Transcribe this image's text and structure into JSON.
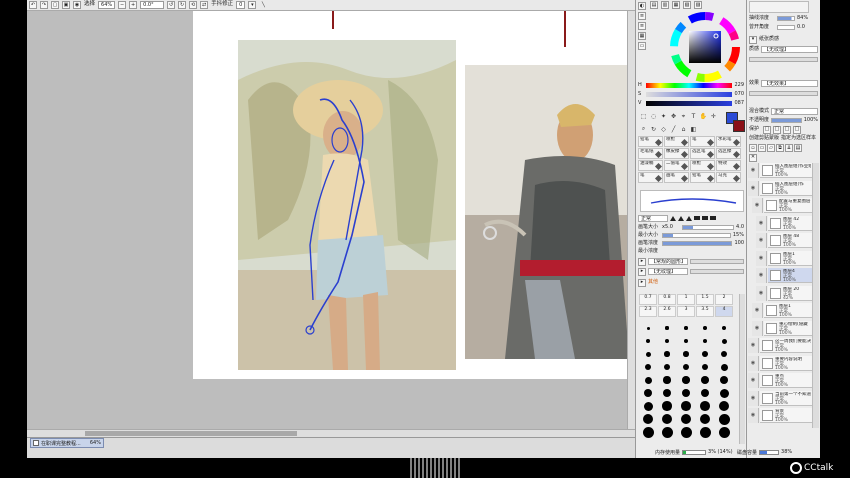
{
  "toolbar": {
    "zoom_mode": "选择",
    "zoom": "64%",
    "angle": "0.0°",
    "stabilizer_label": "手抖修正",
    "stabilizer_value": "0"
  },
  "doc_tab": {
    "name": "在职课完整教程...",
    "zoom": "64%"
  },
  "status": {
    "memory_label": "内存使用量",
    "memory_value": "3% (14%)",
    "disk_label": "磁盘容量",
    "disk_value": "38%"
  },
  "color": {
    "current": "#2b4bd6",
    "secondary": "#8a0f16",
    "h_label": "H",
    "h": "229",
    "s_label": "S",
    "s": "070",
    "v_label": "V",
    "v": "087"
  },
  "brush_tabs": [
    {
      "row": [
        "铅笔",
        "喷枪",
        "笔",
        "水彩笔"
      ]
    },
    {
      "row": [
        "毛笔纸",
        "橡皮擦",
        "选区笔",
        "选区擦"
      ]
    },
    {
      "row": [
        "油漆桶",
        "二值笔",
        "喷枪",
        "特效"
      ]
    },
    {
      "row": [
        "笔",
        "画笔",
        "铅笔",
        "马克"
      ]
    }
  ],
  "brush": {
    "blend": "正常",
    "size_label": "画笔大小",
    "size_mult": "x5.0",
    "size": "4.0",
    "min_size_label": "最小大小",
    "min_size": "15%",
    "density_label": "画笔浓度",
    "density": "100",
    "min_density_label": "最小浓度",
    "tex1": "【常规的圆形】",
    "tex2": "【无纹理】",
    "adv_label": "其他"
  },
  "size_presets": [
    "0.7",
    "0.8",
    "1",
    "1.5",
    "2",
    "2.3",
    "2.6",
    "3",
    "3.5",
    "4"
  ],
  "right": {
    "opacity_label": "抽线浓度",
    "opacity": "84%",
    "angle_label": "曾开角度",
    "angle": "0.0",
    "section1": "纸张质感",
    "texture_label": "质感",
    "texture": "【无纹理】",
    "effect_label": "效果",
    "effect": "【无效果】",
    "blend_label": "混合模式",
    "blend": "正常",
    "layer_opacity_label": "不透明度",
    "layer_opacity": "100%",
    "protect_label": "保护",
    "clip_label": "创建剪贴蒙版",
    "select_label": "指定为选区样本"
  },
  "layers": [
    {
      "name": "插入图层组(作业组",
      "sub1": "正常",
      "sub2": "100%",
      "sel": false,
      "indent": 0
    },
    {
      "name": "插入图层组(作",
      "sub1": "正常",
      "sub2": "100%",
      "sel": false,
      "indent": 0
    },
    {
      "name": "配置与重复图层",
      "sub1": "正常",
      "sub2": "100%",
      "sel": false,
      "indent": 1
    },
    {
      "name": "图层 42",
      "sub1": "正常",
      "sub2": "100%",
      "sel": false,
      "indent": 2
    },
    {
      "name": "图层 48",
      "sub1": "正常",
      "sub2": "100%",
      "sel": false,
      "indent": 2
    },
    {
      "name": "图层1",
      "sub1": "正常",
      "sub2": "100%",
      "sel": false,
      "indent": 2
    },
    {
      "name": "图层4",
      "sub1": "正常",
      "sub2": "100%",
      "sel": true,
      "indent": 2
    },
    {
      "name": "图层 20",
      "sub1": "正常",
      "sub2": "42%",
      "sel": false,
      "indent": 2
    },
    {
      "name": "图层1",
      "sub1": "正常",
      "sub2": "100%",
      "sel": false,
      "indent": 1
    },
    {
      "name": "重心绘制(隐藏",
      "sub1": "正常",
      "sub2": "100%",
      "sel": false,
      "indent": 1
    },
    {
      "name": "这一周我们要能决之",
      "sub1": "正常",
      "sub2": "100%",
      "sel": false,
      "indent": 0
    },
    {
      "name": "重要内容说明",
      "sub1": "正常",
      "sub2": "100%",
      "sel": false,
      "indent": 0
    },
    {
      "name": "重点",
      "sub1": "正常",
      "sub2": "100%",
      "sel": false,
      "indent": 0
    },
    {
      "name": "当前第一个不知道",
      "sub1": "正常",
      "sub2": "100%",
      "sel": false,
      "indent": 0
    },
    {
      "name": "背景",
      "sub1": "正常",
      "sub2": "100%",
      "sel": false,
      "indent": 0
    }
  ],
  "cctalk": "CCtalk"
}
